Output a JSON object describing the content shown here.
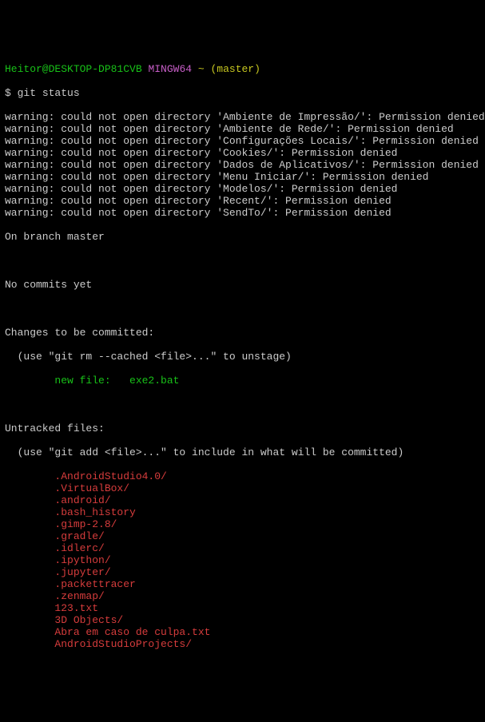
{
  "prompt": {
    "user": "Heitor@DESKTOP-DP81CVB",
    "env": "MINGW64",
    "path": "~",
    "branch": "(master)",
    "dollar": "$ ",
    "cmd": "git status"
  },
  "warnings": [
    "warning: could not open directory 'Ambiente de Impressão/': Permission denied",
    "warning: could not open directory 'Ambiente de Rede/': Permission denied",
    "warning: could not open directory 'Configurações Locais/': Permission denied",
    "warning: could not open directory 'Cookies/': Permission denied",
    "warning: could not open directory 'Dados de Aplicativos/': Permission denied",
    "warning: could not open directory 'Menu Iniciar/': Permission denied",
    "warning: could not open directory 'Modelos/': Permission denied",
    "warning: could not open directory 'Recent/': Permission denied",
    "warning: could not open directory 'SendTo/': Permission denied"
  ],
  "status": {
    "branch": "On branch master",
    "noCommits": "No commits yet",
    "changesHeader": "Changes to be committed:",
    "changesHint": "  (use \"git rm --cached <file>...\" to unstage)",
    "staged": "        new file:   exe2.bat",
    "untrackedHeader": "Untracked files:",
    "untrackedHint": "  (use \"git add <file>...\" to include in what will be committed)"
  },
  "untracked": [
    "        .AndroidStudio4.0/",
    "        .VirtualBox/",
    "        .android/",
    "        .bash_history",
    "        .gimp-2.8/",
    "        .gradle/",
    "        .idlerc/",
    "        .ipython/",
    "        .jupyter/",
    "        .packettracer",
    "        .zenmap/",
    "        123.txt",
    "        3D Objects/",
    "        Abra em caso de culpa.txt",
    "        AndroidStudioProjects/"
  ]
}
